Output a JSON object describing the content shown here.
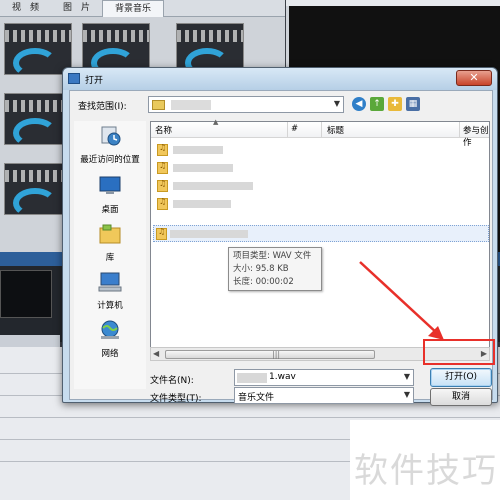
{
  "background_app": {
    "tabs": [
      "视　频",
      "图　片",
      "背景音乐"
    ],
    "active_tab": 2
  },
  "dialog": {
    "title": "打开",
    "close_label": "✕",
    "look_in_label": "查找范围(I):",
    "places": [
      {
        "label": "最近访问的位置",
        "icon": "recent-places-icon"
      },
      {
        "label": "桌面",
        "icon": "desktop-icon"
      },
      {
        "label": "库",
        "icon": "libraries-icon"
      },
      {
        "label": "计算机",
        "icon": "computer-icon"
      },
      {
        "label": "网络",
        "icon": "network-icon"
      }
    ],
    "columns": [
      "名称",
      "#",
      "标题",
      "参与创作"
    ],
    "tooltip": {
      "type": "项目类型: WAV 文件",
      "size": "大小: 95.8 KB",
      "length": "长度: 00:00:02"
    },
    "scroll_grip": "|||",
    "filename_label": "文件名(N):",
    "filename_value": "1.wav",
    "filetype_label": "文件类型(T):",
    "filetype_value": "音乐文件",
    "open_button": "打开(O)",
    "cancel_button": "取消"
  },
  "watermark": "软件技巧",
  "colors": {
    "annotation_red": "#e8302a",
    "title_bar": "#b6cfe6",
    "preview_black": "#111111"
  }
}
